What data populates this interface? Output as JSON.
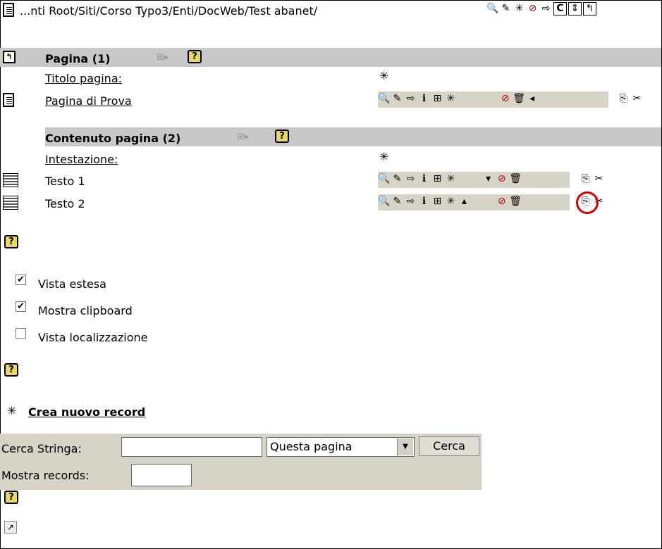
{
  "path_bar": {
    "path_text": "...nti Root/Siti/Corso Typo3/Enti/DocWeb/Test abanet/",
    "toolbar_icons": [
      "zoom-icon",
      "view-icon",
      "new-record-icon",
      "edit-icon",
      "move-icon",
      "clipboard-icon",
      "sort-icon",
      "up-icon"
    ],
    "toolbar_glyphs": [
      "🔍",
      "✎",
      "✳",
      "⊘",
      "⇨",
      "C",
      "⇕",
      "↰"
    ]
  },
  "page_section": {
    "header_label": "Pagina (1)",
    "expand_glyph": "⊞▸",
    "help_glyph": "?",
    "column_label": "Titolo pagina:",
    "new_glyph": "✳",
    "row_title": "Pagina di Prova",
    "row_icons_left": [
      "🔍",
      "✎",
      "⇨",
      "ℹ",
      "⊞",
      "✳"
    ],
    "row_icons_right": [
      "⊘",
      "🗑",
      "◂"
    ],
    "row_icons_clip": [
      "⎘",
      "✂"
    ]
  },
  "content_section": {
    "header_label": "Contenuto pagina (2)",
    "expand_glyph": "⊞▸",
    "help_glyph": "?",
    "column_label": "Intestazione:",
    "new_glyph": "✳",
    "rows": [
      {
        "title": "Testo 1",
        "icons_left": [
          "🔍",
          "✎",
          "⇨",
          "ℹ",
          "⊞",
          "✳"
        ],
        "icons_right": [
          "▾",
          "⊘",
          "🗑"
        ],
        "icons_clip": [
          "⎘",
          "✂"
        ]
      },
      {
        "title": "Testo 2",
        "icons_left": [
          "🔍",
          "✎",
          "⇨",
          "ℹ",
          "⊞",
          "✳",
          "▴"
        ],
        "icons_right": [
          "⊘",
          "🗑"
        ],
        "icons_clip": [
          "⎘",
          "✂"
        ]
      }
    ]
  },
  "options": {
    "help_glyph": "?",
    "checkboxes": [
      {
        "label": "Vista estesa",
        "checked": true
      },
      {
        "label": "Mostra clipboard",
        "checked": true
      },
      {
        "label": "Vista localizzazione",
        "checked": false
      }
    ],
    "check_mark": "✔"
  },
  "new_record": {
    "glyph": "✳",
    "label": "Crea nuovo record"
  },
  "search": {
    "search_label": "Cerca Stringa:",
    "search_value": "",
    "scope_value": "Questa pagina",
    "scope_arrow": "▼",
    "button_label": "Cerca",
    "records_label": "Mostra records:",
    "records_value": ""
  },
  "footer": {
    "help_glyph": "?",
    "corner_glyph": "↗"
  }
}
